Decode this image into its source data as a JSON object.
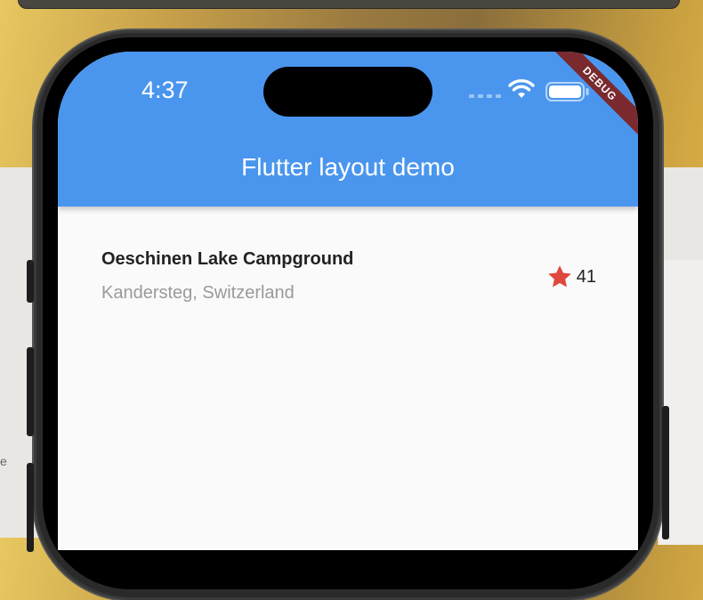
{
  "status_bar": {
    "time": "4:37",
    "icons": [
      "signal-icon",
      "wifi-icon",
      "battery-icon"
    ]
  },
  "debug_banner": "DEBUG",
  "app_bar": {
    "title": "Flutter layout demo"
  },
  "title_section": {
    "name": "Oeschinen Lake Campground",
    "location": "Kandersteg, Switzerland",
    "rating": {
      "icon": "star-icon",
      "count": "41"
    }
  },
  "colors": {
    "app_bar": "#4a96ee",
    "star": "#e0473d",
    "debug_banner": "#7a2a2e",
    "background": "#fafafa",
    "location_text": "#9a9a9a"
  }
}
